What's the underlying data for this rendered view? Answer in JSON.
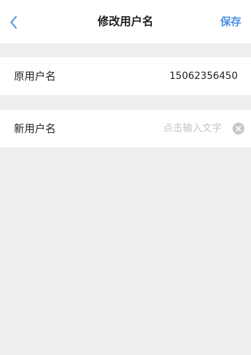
{
  "navbar": {
    "title": "修改用户名",
    "save_label": "保存",
    "back_icon": "chevron-left-icon",
    "accent_color": "#4a90e2"
  },
  "old_username": {
    "label": "原用户名",
    "value": "15062356450"
  },
  "new_username": {
    "label": "新用户名",
    "value": "",
    "placeholder": "点击输入文字",
    "clear_icon": "clear-circle-icon"
  }
}
